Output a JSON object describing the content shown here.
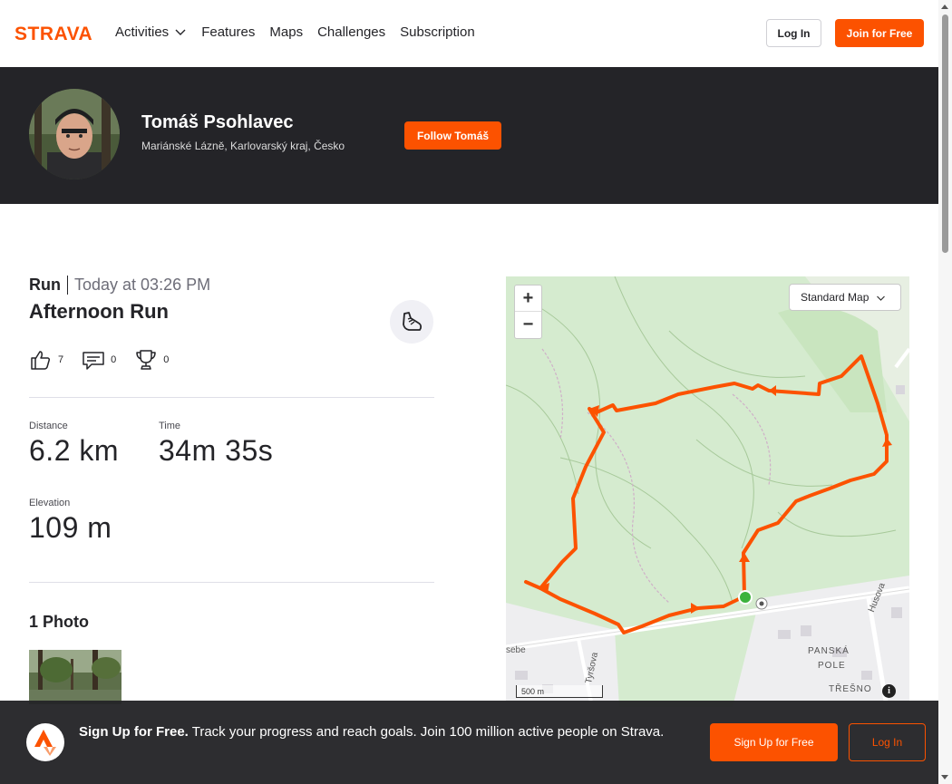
{
  "nav": {
    "logo": "STRAVA",
    "links": [
      "Activities",
      "Features",
      "Maps",
      "Challenges",
      "Subscription"
    ],
    "login": "Log In",
    "join": "Join for Free"
  },
  "athlete": {
    "name": "Tomáš Psohlavec",
    "location": "Mariánské Lázně, Karlovarský kraj, Česko",
    "follow": "Follow Tomáš"
  },
  "activity": {
    "type": "Run",
    "time": "Today at 03:26 PM",
    "title": "Afternoon Run",
    "kudos": "7",
    "comments": "0",
    "achievements": "0",
    "stats": {
      "distance_label": "Distance",
      "distance": "6.2 km",
      "time_label": "Time",
      "time": "34m 35s",
      "elevation_label": "Elevation",
      "elevation": "109 m"
    },
    "photos_title": "1 Photo"
  },
  "map": {
    "type": "Standard Map",
    "scale": "500 m",
    "zoom_in": "+",
    "zoom_out": "−",
    "labels": {
      "panska": "PANSKÁ",
      "pole": "POLE",
      "tresno": "TŘEŠNO",
      "husova": "Husova",
      "tyrsova": "Tyršova",
      "sebe": "sebe"
    }
  },
  "banner": {
    "bold": "Sign Up for Free.",
    "text": " Track your progress and reach goals. Join 100 million active people on Strava.",
    "signup": "Sign Up for Free",
    "login": "Log In"
  },
  "colors": {
    "brand": "#fc5200",
    "dark": "#242428",
    "route": "#fc5200",
    "start": "#3cb33c"
  }
}
